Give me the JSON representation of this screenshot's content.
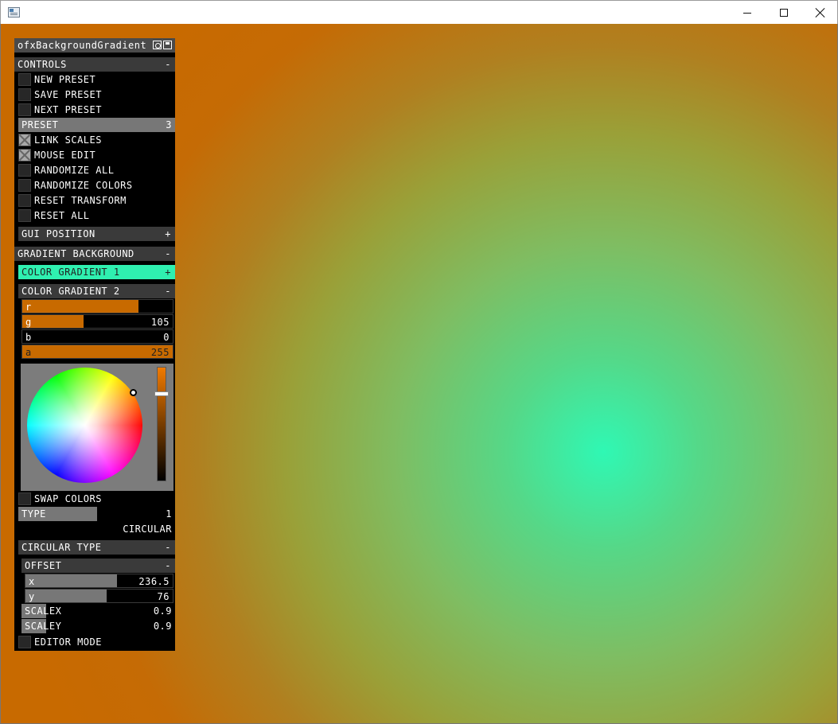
{
  "window": {
    "title": ""
  },
  "colors": {
    "accent_orange": "#c86a00",
    "accent_teal": "#2ff0b0",
    "slider_fill": "#777777",
    "panel_bg": "#000000",
    "header_bg": "#3a3a3a"
  },
  "icons": {
    "app": "app-window-icon",
    "minimize": "minimize-icon",
    "maximize": "maximize-icon",
    "close": "close-icon",
    "load": "load-preset-icon",
    "save": "save-preset-icon"
  },
  "panel": {
    "title": "ofxBackgroundGradient",
    "controls": {
      "header": "CONTROLS",
      "collapse": "-",
      "new_preset": "NEW PRESET",
      "save_preset": "SAVE PRESET",
      "next_preset": "NEXT PRESET",
      "preset": {
        "label": "PRESET",
        "value": "3",
        "fraction": 1.0
      },
      "link_scales": {
        "label": "LINK SCALES",
        "checked": true
      },
      "mouse_edit": {
        "label": "MOUSE EDIT",
        "checked": true
      },
      "randomize_all": "RANDOMIZE ALL",
      "randomize_colors": "RANDOMIZE COLORS",
      "reset_transform": "RESET TRANSFORM",
      "reset_all": "RESET ALL"
    },
    "gui_position": {
      "header": "GUI POSITION",
      "expand": "+"
    },
    "gradient_background": {
      "header": "GRADIENT BACKGROUND",
      "collapse": "-",
      "color_gradient_1": {
        "header": "COLOR GRADIENT 1",
        "expand": "+"
      },
      "color_gradient_2": {
        "header": "COLOR GRADIENT 2",
        "collapse": "-",
        "r": {
          "label": "r",
          "value": "",
          "fraction": 0.77
        },
        "g": {
          "label": "g",
          "value": "105",
          "fraction": 0.41
        },
        "b": {
          "label": "b",
          "value": "0",
          "fraction": 0.0
        },
        "a": {
          "label": "a",
          "value": "255",
          "fraction": 1.0
        }
      },
      "swap_colors": {
        "label": "SWAP COLORS",
        "checked": false
      },
      "type": {
        "label": "TYPE",
        "value": "1",
        "fraction": 0.5
      },
      "type_name": "CIRCULAR"
    },
    "circular_type": {
      "header": "CIRCULAR TYPE",
      "collapse": "-",
      "offset": {
        "header": "OFFSET",
        "collapse": "-",
        "x": {
          "label": "x",
          "value": "236.5",
          "fraction": 0.62
        },
        "y": {
          "label": "y",
          "value": "76",
          "fraction": 0.55
        }
      },
      "scalex": {
        "label": "SCALEX",
        "value": "0.9",
        "fraction": 0.16
      },
      "scaley": {
        "label": "SCALEY",
        "value": "0.9",
        "fraction": 0.16
      }
    },
    "editor_mode": {
      "label": "EDITOR MODE",
      "checked": false
    }
  }
}
